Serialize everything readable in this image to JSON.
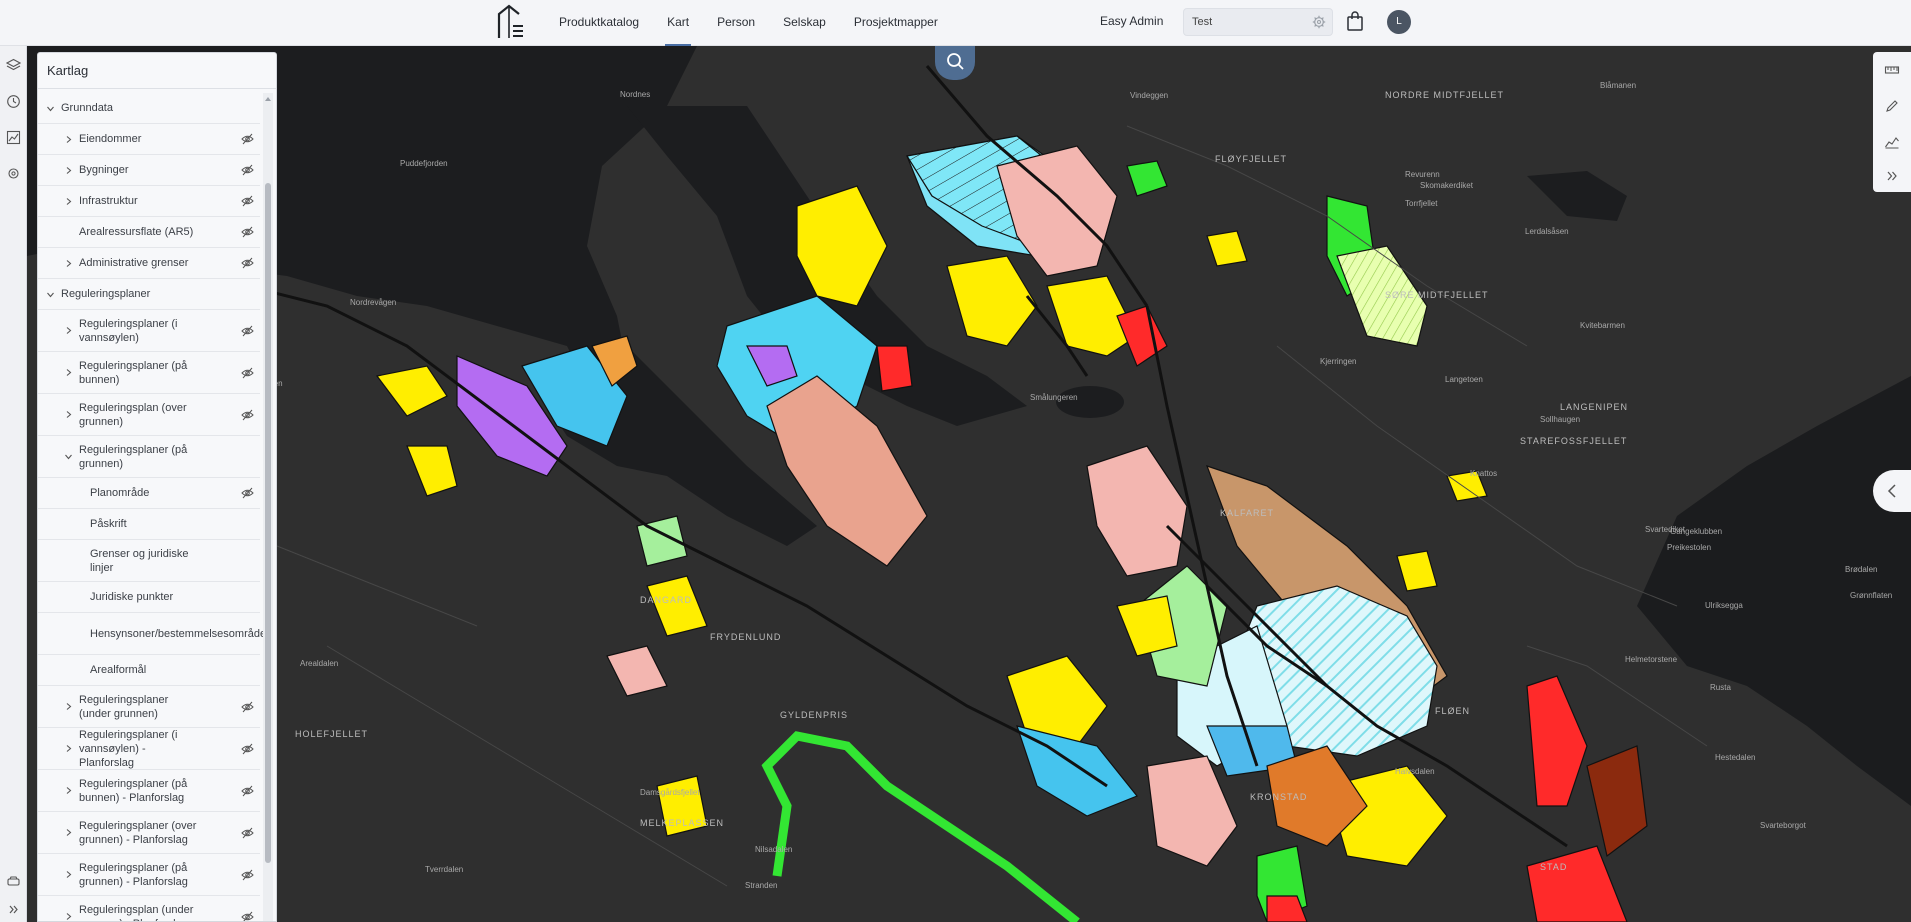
{
  "topbar": {
    "nav": [
      {
        "label": "Produktkatalog",
        "active": false
      },
      {
        "label": "Kart",
        "active": true
      },
      {
        "label": "Person",
        "active": false
      },
      {
        "label": "Selskap",
        "active": false
      },
      {
        "label": "Prosjektmapper",
        "active": false
      }
    ],
    "admin_label": "Easy Admin",
    "search_value": "Test",
    "avatar_initial": "L",
    "accent_color": "#4a6fa5"
  },
  "panel": {
    "title": "Kartlag",
    "items": [
      {
        "label": "Grunndata",
        "level": 0,
        "expanded": true,
        "eye": false,
        "chevron": true
      },
      {
        "label": "Eiendommer",
        "level": 1,
        "expanded": false,
        "eye": true,
        "chevron": true
      },
      {
        "label": "Bygninger",
        "level": 1,
        "expanded": false,
        "eye": true,
        "chevron": true
      },
      {
        "label": "Infrastruktur",
        "level": 1,
        "expanded": false,
        "eye": true,
        "chevron": true
      },
      {
        "label": "Arealressursflate (AR5)",
        "level": 1,
        "expanded": false,
        "eye": true,
        "chevron": false
      },
      {
        "label": "Administrative grenser",
        "level": 1,
        "expanded": false,
        "eye": true,
        "chevron": true
      },
      {
        "label": "Reguleringsplaner",
        "level": 0,
        "expanded": true,
        "eye": false,
        "chevron": true
      },
      {
        "label": "Reguleringsplaner (i vannsøylen)",
        "level": 1,
        "expanded": false,
        "eye": true,
        "chevron": true
      },
      {
        "label": "Reguleringsplaner (på bunnen)",
        "level": 1,
        "expanded": false,
        "eye": true,
        "chevron": true
      },
      {
        "label": "Reguleringsplan (over grunnen)",
        "level": 1,
        "expanded": false,
        "eye": true,
        "chevron": true
      },
      {
        "label": "Reguleringsplaner (på grunnen)",
        "level": 1,
        "expanded": true,
        "eye": false,
        "chevron": true
      },
      {
        "label": "Planområde",
        "level": 2,
        "expanded": false,
        "eye": true,
        "chevron": false
      },
      {
        "label": "Påskrift",
        "level": 2,
        "expanded": false,
        "eye": false,
        "chevron": false
      },
      {
        "label": "Grenser og juridiske linjer",
        "level": 2,
        "expanded": false,
        "eye": false,
        "chevron": false
      },
      {
        "label": "Juridiske punkter",
        "level": 2,
        "expanded": false,
        "eye": false,
        "chevron": false
      },
      {
        "label": "Hensynsoner/bestemmelsesområder",
        "level": 2,
        "expanded": false,
        "eye": false,
        "chevron": false
      },
      {
        "label": "Arealformål",
        "level": 2,
        "expanded": false,
        "eye": false,
        "chevron": false
      },
      {
        "label": "Reguleringsplaner (under grunnen)",
        "level": 1,
        "expanded": false,
        "eye": true,
        "chevron": true
      },
      {
        "label": "Reguleringsplaner (i vannsøylen) - Planforslag",
        "level": 1,
        "expanded": false,
        "eye": true,
        "chevron": true
      },
      {
        "label": "Reguleringsplaner (på bunnen) - Planforslag",
        "level": 1,
        "expanded": false,
        "eye": true,
        "chevron": true
      },
      {
        "label": "Reguleringsplaner (over grunnen) - Planforslag",
        "level": 1,
        "expanded": false,
        "eye": true,
        "chevron": true
      },
      {
        "label": "Reguleringsplaner (på grunnen) - Planforslag",
        "level": 1,
        "expanded": false,
        "eye": true,
        "chevron": true
      },
      {
        "label": "Reguleringsplan (under grunnen) - Planforslag",
        "level": 1,
        "expanded": false,
        "eye": true,
        "chevron": true
      }
    ]
  },
  "map": {
    "place_labels": [
      "NORDRE MIDTFJELLET",
      "FLØYFJELLET",
      "SØRE MIDTFJELLET",
      "LANGENIPEN",
      "STAREFOSSFJELLET",
      "FLØEN",
      "KALFARET",
      "DANGARD",
      "FRYDENLUND",
      "GYLDENPRIS",
      "MELKEPLASSEN",
      "HOLEFJELLET",
      "KRONSTAD",
      "STAD",
      "Blåmanen",
      "Vindeggen",
      "Revurenn",
      "Skomakerdiket",
      "Torrfjellet",
      "Lerdalsåsen",
      "Kjerringen",
      "Langetoen",
      "Sollhaugen",
      "Knattos",
      "Svartediket",
      "Gangeklubben",
      "Preikestolen",
      "Kvitebarmen",
      "Brødalen",
      "Grønnflaten",
      "Ulriksegga",
      "Helmetorstene",
      "Rusta",
      "Halvsdalen",
      "Hestedalen",
      "Svarteborgot",
      "Nilsadalen",
      "Stranden",
      "Damsgårdsfjellet",
      "Tverrdalen",
      "Nordrevågen",
      "Puddefjorden",
      "Smålungeren",
      "Arealdalen",
      "Hovden",
      "Nordnes"
    ]
  }
}
